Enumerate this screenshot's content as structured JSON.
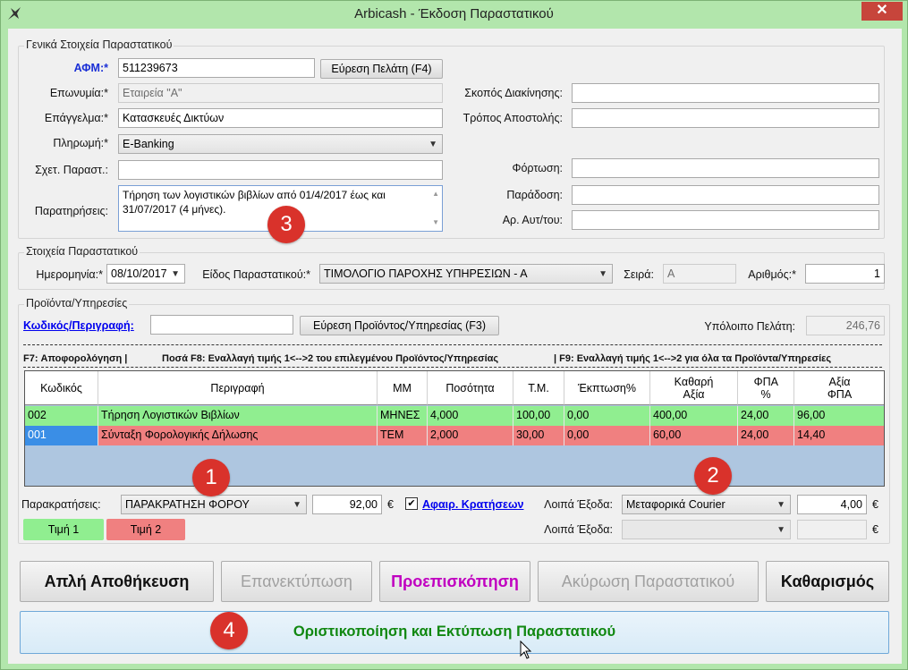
{
  "window": {
    "title": "Arbicash - Έκδοση Παραστατικού",
    "close": "✕"
  },
  "general": {
    "title": "Γενικά Στοιχεία Παραστατικού",
    "afm_label": "ΑΦΜ:*",
    "afm_value": "511239673",
    "find_customer": "Εύρεση Πελάτη (F4)",
    "name_label": "Επωνυμία:*",
    "name_value": "Εταιρεία \"Α\"",
    "job_label": "Επάγγελμα:*",
    "job_value": "Κατασκευές Δικτύων",
    "payment_label": "Πληρωμή:*",
    "payment_value": "E-Banking",
    "related_label": "Σχετ. Παραστ.:",
    "related_value": "",
    "notes_label": "Παρατηρήσεις:",
    "notes_value": "Τήρηση των λογιστικών βιβλίων από 01/4/2017 έως και 31/07/2017 (4 μήνες).",
    "purpose_label": "Σκοπός Διακίνησης:",
    "purpose_value": "",
    "shipping_label": "Τρόπος Αποστολής:",
    "shipping_value": "",
    "loading_label": "Φόρτωση:",
    "loading_value": "",
    "delivery_label": "Παράδοση:",
    "delivery_value": "",
    "vehicle_label": "Αρ. Αυτ/του:",
    "vehicle_value": ""
  },
  "document": {
    "title": "Στοιχεία Παραστατικού",
    "date_label": "Ημερομηνία:*",
    "date_value": "08/10/2017",
    "type_label": "Είδος Παραστατικού:*",
    "type_value": "ΤΙΜΟΛΟΓΙΟ ΠΑΡΟΧΗΣ ΥΠΗΡΕΣΙΩΝ - Α",
    "series_label": "Σειρά:",
    "series_value": "Α",
    "number_label": "Αριθμός:*",
    "number_value": "1"
  },
  "products": {
    "title": "Προϊόντα/Υπηρεσίες",
    "code_label": "Κωδικός/Περιγραφή:",
    "code_value": "",
    "find_product": "Εύρεση Προϊόντος/Υπηρεσίας (F3)",
    "balance_label": "Υπόλοιπο Πελάτη:",
    "balance_value": "246,76",
    "hint_f7": "F7: Αποφορολόγηση   |",
    "hint_f8": "Ποσά F8: Εναλλαγή τιμής 1<-->2 του επιλεγμένου Προϊόντος/Υπηρεσίας",
    "hint_f9": "|   F9: Εναλλαγή τιμής 1<-->2 για όλα τα Προϊόντα/Υπηρεσίες",
    "columns": [
      "Κωδικός",
      "Περιγραφή",
      "ΜΜ",
      "Ποσότητα",
      "Τ.Μ.",
      "Έκπτωση%",
      "Καθαρή Αξία",
      "ΦΠΑ %",
      "Αξία ΦΠΑ"
    ],
    "rows": [
      {
        "code": "002",
        "desc": "Τήρηση Λογιστικών Βιβλίων",
        "mm": "ΜΗΝΕΣ",
        "qty": "4,000",
        "price": "100,00",
        "disc": "0,00",
        "net": "400,00",
        "vat": "24,00",
        "vat_val": "96,00"
      },
      {
        "code": "001",
        "desc": "Σύνταξη Φορολογικής Δήλωσης",
        "mm": "ΤΕΜ",
        "qty": "2,000",
        "price": "30,00",
        "disc": "0,00",
        "net": "60,00",
        "vat": "24,00",
        "vat_val": "14,40"
      }
    ],
    "withholding_label": "Παρακρατήσεις:",
    "withholding_value": "ΠΑΡΑΚΡΑΤΗΣΗ ΦΟΡΟΥ",
    "withholding_amount": "92,00",
    "euro": "€",
    "deduct_label": "Αφαιρ. Κρατήσεων",
    "deduct_checked": "✔",
    "other1_label": "Λοιπά Έξοδα:",
    "other1_value": "Μεταφορικά Courier",
    "other1_amount": "4,00",
    "other2_label": "Λοιπά Έξοδα:",
    "other2_value": "",
    "other2_amount": "",
    "price1": "Τιμή 1",
    "price2": "Τιμή 2"
  },
  "actions": {
    "save": "Απλή Αποθήκευση",
    "reprint": "Επανεκτύπωση",
    "preview": "Προεπισκόπηση",
    "cancel": "Ακύρωση Παραστατικού",
    "clear": "Καθαρισμός",
    "finalize": "Οριστικοποίηση και Εκτύπωση Παραστατικού"
  },
  "badges": {
    "b1": "1",
    "b2": "2",
    "b3": "3",
    "b4": "4"
  },
  "colors": {
    "row_green": "#90ee90",
    "row_red": "#f08080",
    "grid_bg": "#aec6e0",
    "badge": "#d9322b",
    "preview_text": "#c000c0",
    "finalize_text": "#118811"
  }
}
